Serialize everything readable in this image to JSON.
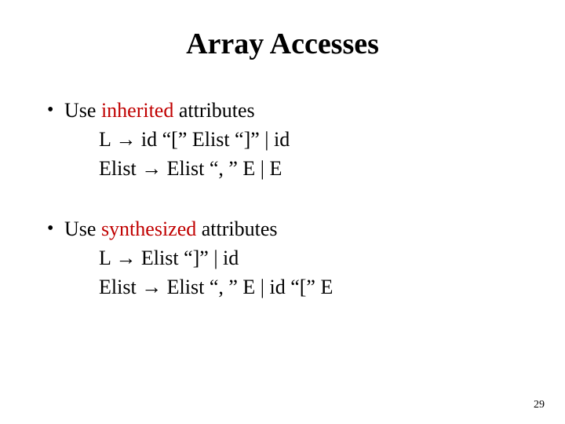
{
  "title": "Array Accesses",
  "block1": {
    "lead": {
      "pre": "Use ",
      "key": "inherited",
      "post": " attributes"
    },
    "line1": "L → id  “[”  Elist  “]”  |  id",
    "line2": "Elist  → Elist  “, ”  E  |  E"
  },
  "block2": {
    "lead": {
      "pre": "Use ",
      "key": "synthesized",
      "post": " attributes"
    },
    "line1": "L → Elist  “]”  |  id",
    "line2": "Elist  → Elist  “, ”  E  |  id  “[”  E"
  },
  "pageNumber": "29"
}
